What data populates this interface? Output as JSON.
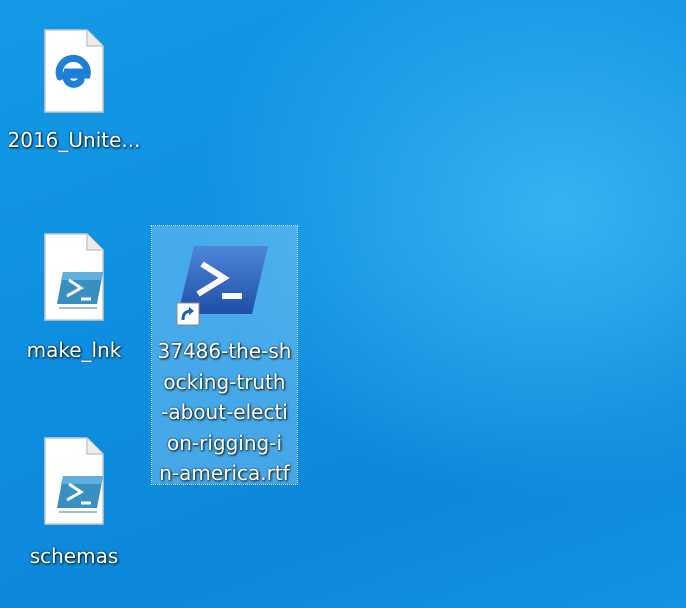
{
  "desktop": {
    "icons": [
      {
        "label": "2016_Unite...",
        "icon": "edge-document-icon"
      },
      {
        "label": "make_lnk",
        "icon": "powershell-script-icon"
      },
      {
        "label": "schemas",
        "icon": "powershell-script-icon"
      }
    ],
    "selected_shortcut": {
      "label": "37486-the-shocking-truth-about-election-rigging-in-america.rtf",
      "label_lines": "37486-the-sh\nocking-truth\n-about-electi\non-rigging-i\nn-america.rtf",
      "icon": "powershell-icon",
      "overlay": "shortcut-arrow-icon",
      "selected": true
    }
  },
  "colors": {
    "background": "#1293e3",
    "edge_blue": "#1e7fd6",
    "powershell_blue": "#2b5fb7",
    "label_text": "#ffffff"
  }
}
